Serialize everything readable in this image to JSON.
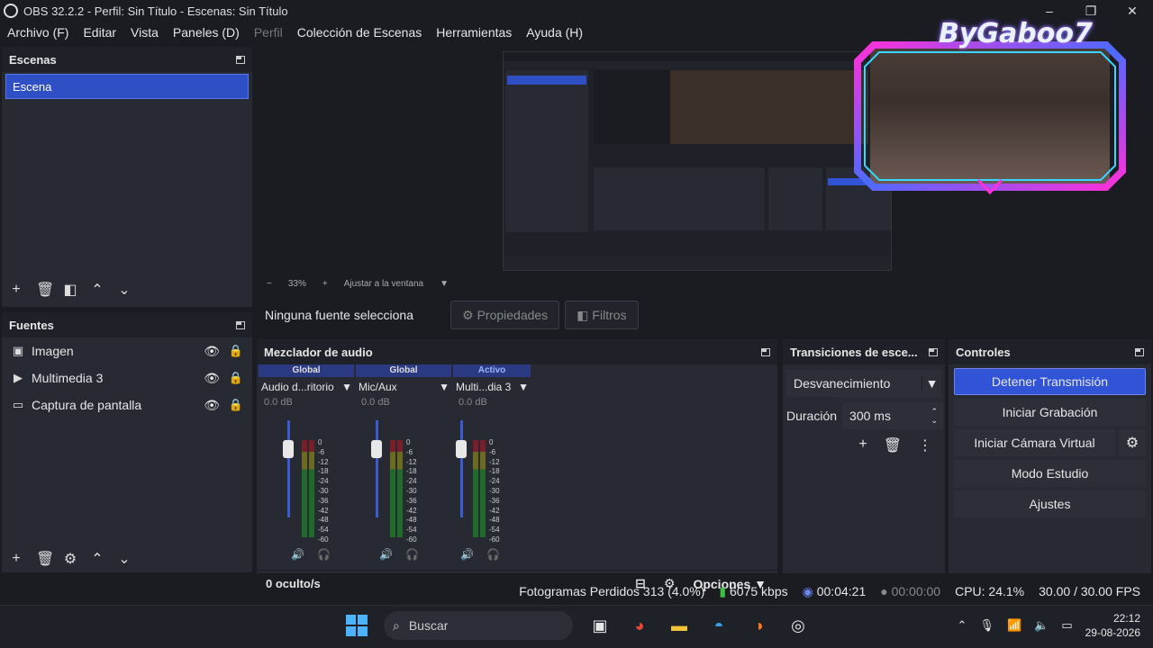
{
  "window": {
    "title": "OBS 32.2.2 - Perfil: Sin Título - Escenas: Sin Título",
    "minimize": "–",
    "maximize": "❐",
    "close": "✕"
  },
  "menu": [
    "Archivo (F)",
    "Editar",
    "Vista",
    "Paneles (D)",
    "Perfil",
    "Colección de Escenas",
    "Herramientas",
    "Ayuda (H)"
  ],
  "scenes": {
    "title": "Escenas",
    "items": [
      "Escena"
    ]
  },
  "sources": {
    "title": "Fuentes",
    "items": [
      {
        "name": "Imagen",
        "icon": "image-icon"
      },
      {
        "name": "Multimedia 3",
        "icon": "play-icon"
      },
      {
        "name": "Captura de pantalla",
        "icon": "monitor-icon"
      }
    ]
  },
  "preview": {
    "zoom_minus": "−",
    "zoom": "33%",
    "zoom_plus": "+",
    "fit": "Ajustar a la ventana",
    "overlay_text": "ByGaboo7"
  },
  "properties_bar": {
    "no_source": "Ninguna fuente selecciona",
    "properties": "Propiedades",
    "filters": "Filtros"
  },
  "mixer": {
    "title": "Mezclador de audio",
    "channels": [
      {
        "tag": "Global",
        "name": "Audio d...ritorio",
        "db": "0.0 dB"
      },
      {
        "tag": "Global",
        "name": "Mic/Aux",
        "db": "0.0 dB"
      },
      {
        "tag": "Activo",
        "name": "Multi...dia 3",
        "db": "0.0 dB"
      }
    ],
    "scale": [
      "0",
      "-6",
      "-12",
      "-18",
      "-24",
      "-30",
      "-36",
      "-42",
      "-48",
      "-54",
      "-60"
    ],
    "hidden": "0 oculto/s",
    "options": "Opciones"
  },
  "transitions": {
    "title": "Transiciones de esce...",
    "selected": "Desvanecimiento",
    "duration_label": "Duración",
    "duration": "300 ms"
  },
  "controls": {
    "title": "Controles",
    "stop_stream": "Detener Transmisión",
    "start_recording": "Iniciar Grabación",
    "virtual_camera": "Iniciar Cámara Virtual",
    "studio_mode": "Modo Estudio",
    "settings": "Ajustes"
  },
  "status": {
    "dropped_frames": "Fotogramas Perdidos 313 (4.0%)",
    "bitrate": "6075 kbps",
    "stream_time": "00:04:21",
    "rec_time": "00:00:00",
    "cpu": "CPU: 24.1%",
    "fps": "30.00 / 30.00 FPS"
  },
  "taskbar": {
    "search": "Buscar",
    "time": "22:12",
    "date": "29-08-2026"
  },
  "colors": {
    "accent": "#3154d6",
    "dock": "#272a33",
    "background": "#1b1c22"
  }
}
